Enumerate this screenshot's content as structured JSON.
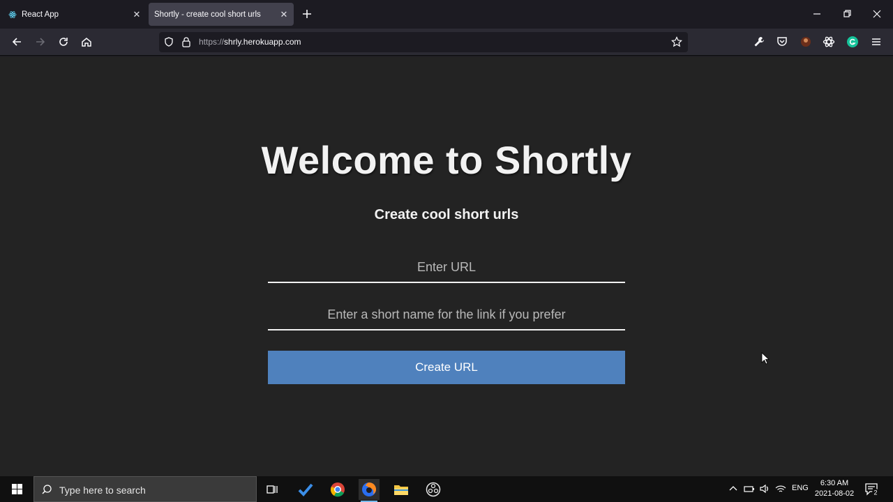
{
  "browser": {
    "tabs": [
      {
        "title": "React App",
        "active": false
      },
      {
        "title": "Shortly - create cool short urls",
        "active": true
      }
    ],
    "url": {
      "scheme": "https://",
      "host": "shrly.herokuapp.com"
    }
  },
  "page": {
    "title": "Welcome to Shortly",
    "subtitle": "Create cool short urls",
    "url_input": {
      "placeholder": "Enter URL",
      "value": ""
    },
    "short_input": {
      "placeholder": "Enter a short name for the link if you prefer",
      "value": ""
    },
    "create_button": "Create URL"
  },
  "taskbar": {
    "search_placeholder": "Type here to search",
    "language": "ENG",
    "time": "6:30 AM",
    "date": "2021-08-02",
    "notification_count": "2"
  },
  "colors": {
    "accent": "#4f81bd",
    "page_bg": "#232323"
  }
}
